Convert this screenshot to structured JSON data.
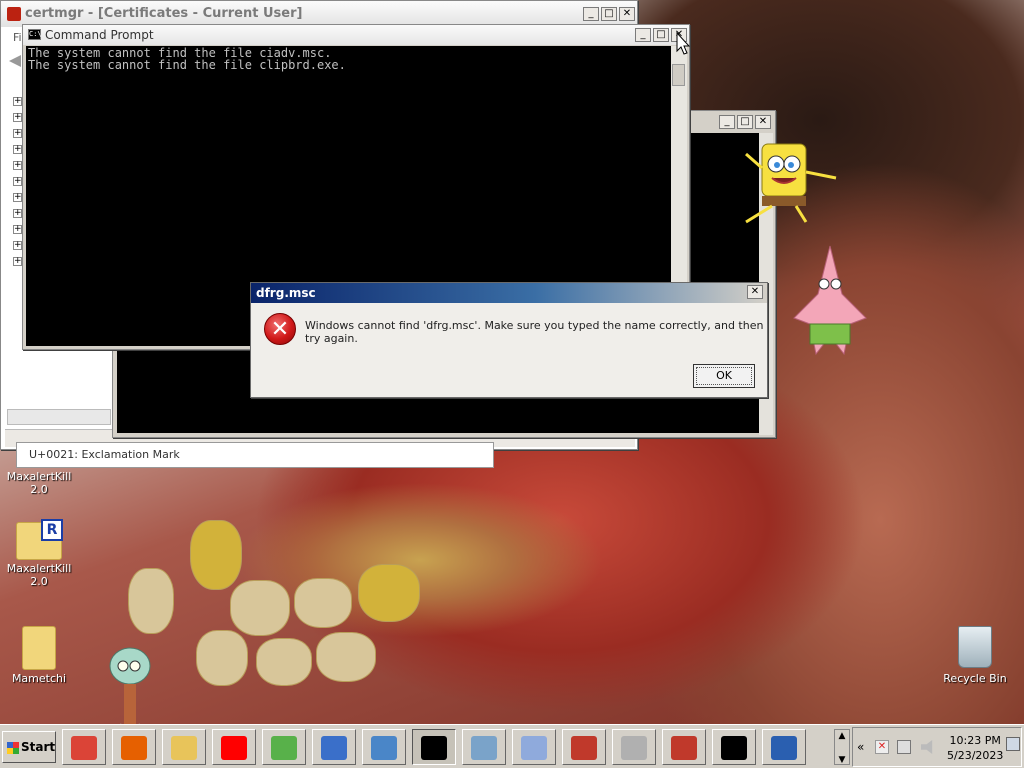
{
  "cert_window": {
    "title": "certmgr - [Certificates - Current User]",
    "menu_first": "Fi",
    "tree_expanders": [
      "+",
      "+",
      "+",
      "+",
      "+",
      "+",
      "+",
      "+",
      "+",
      "+",
      "+"
    ],
    "status_behind": "U+0021: Exclamation Mark"
  },
  "cmd_window": {
    "title": "Command Prompt",
    "icon_text": "C:\\",
    "lines": [
      "The system cannot find the file ciadv.msc.",
      "The system cannot find the file clipbrd.exe."
    ]
  },
  "dialog": {
    "title": "dfrg.msc",
    "message": "Windows cannot find 'dfrg.msc'. Make sure you typed the name correctly, and then try again.",
    "ok_label": "OK",
    "icon": "error-icon",
    "icon_glyph": "✕"
  },
  "window_controls": {
    "minimize": "_",
    "maximize": "□",
    "close": "✕"
  },
  "desktop": {
    "icons": [
      {
        "label": "MaxalertKill 2.0"
      },
      {
        "label": "MaxalertKill 2.0",
        "badge": "R"
      },
      {
        "label": "Mametchi"
      },
      {
        "label": "Recycle Bin"
      }
    ]
  },
  "taskbar": {
    "start_label": "Start",
    "buttons": [
      {
        "name": "chrome",
        "color": "#db4437"
      },
      {
        "name": "firefox",
        "color": "#e66000"
      },
      {
        "name": "explorer-folder",
        "color": "#e8c45a"
      },
      {
        "name": "yandex",
        "color": "#ff0000"
      },
      {
        "name": "green-app",
        "color": "#58b14a"
      },
      {
        "name": "wordpad",
        "color": "#3a6fc9"
      },
      {
        "name": "network-tool",
        "color": "#4a86c8"
      },
      {
        "name": "command-prompt",
        "color": "#000000",
        "active": true
      },
      {
        "name": "calculator",
        "color": "#7aa3c9"
      },
      {
        "name": "lambda-app",
        "color": "#8faadc"
      },
      {
        "name": "toolbox",
        "color": "#c0392b"
      },
      {
        "name": "printer",
        "color": "#b0b0b0"
      },
      {
        "name": "toolbox-2",
        "color": "#c0392b"
      },
      {
        "name": "command-prompt-2",
        "color": "#000000"
      },
      {
        "name": "security-shield",
        "color": "#2a5fb0"
      }
    ],
    "tray_expand": "«",
    "clock_time": "10:23 PM",
    "clock_date": "5/23/2023"
  }
}
